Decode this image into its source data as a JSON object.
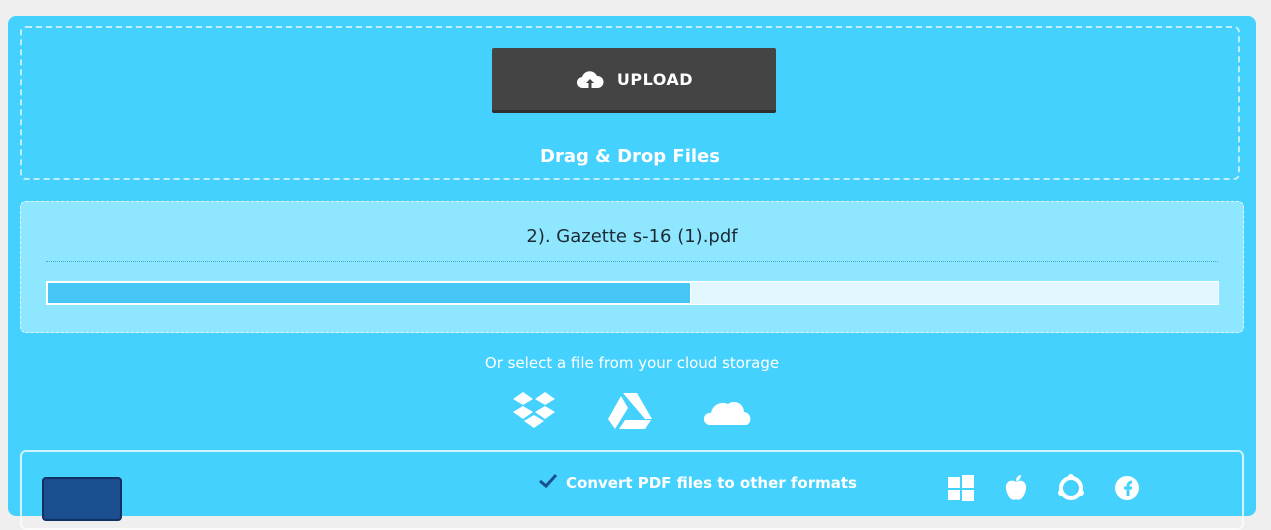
{
  "upload": {
    "button_label": "UPLOAD",
    "drag_text": "Drag & Drop Files"
  },
  "file": {
    "name": "2). Gazette s-16 (1).pdf",
    "progress": 0.55
  },
  "cloud": {
    "prompt": "Or select a file from your cloud storage",
    "providers": [
      "dropbox-icon",
      "google-drive-icon",
      "onedrive-icon"
    ]
  },
  "features": {
    "item1": "Convert PDF files to other formats"
  },
  "platforms": [
    "windows-icon",
    "apple-icon",
    "ubuntu-icon",
    "fedora-icon"
  ],
  "colors": {
    "panel": "#45d1fe",
    "button": "#444444",
    "progress_fill": "#45c6f5",
    "file_card": "#8fe6ff"
  }
}
